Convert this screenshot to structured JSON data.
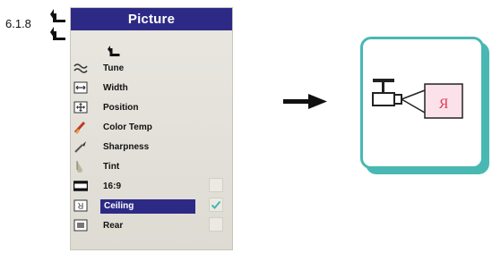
{
  "section": {
    "number": "6.1.8"
  },
  "menu": {
    "title": "Picture",
    "items": [
      {
        "label": "Tune",
        "icon": "tune-icon"
      },
      {
        "label": "Width",
        "icon": "width-icon"
      },
      {
        "label": "Position",
        "icon": "position-icon"
      },
      {
        "label": "Color Temp",
        "icon": "color-temp-icon"
      },
      {
        "label": "Sharpness",
        "icon": "sharpness-icon"
      },
      {
        "label": "Tint",
        "icon": "tint-icon"
      },
      {
        "label": "16:9",
        "icon": "aspect-ratio-icon",
        "checked": false
      },
      {
        "label": "Ceiling",
        "icon": "ceiling-icon",
        "checked": true,
        "selected": true
      },
      {
        "label": "Rear",
        "icon": "rear-icon",
        "checked": false
      }
    ]
  },
  "diagram": {
    "screen_glyph": "R",
    "colors": {
      "teal": "#49b8b3",
      "menu_blue": "#2d2a86",
      "screen_pink": "#fbe2ea",
      "glyph_red": "#e33b55"
    }
  }
}
